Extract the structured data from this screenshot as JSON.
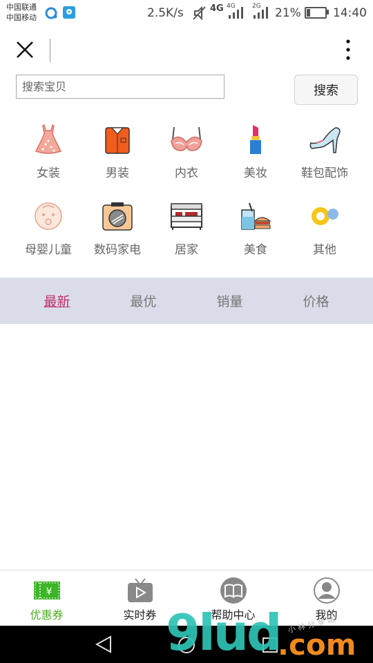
{
  "status_bar": {
    "carrier_line1": "中国联通",
    "carrier_line2": "中国移动",
    "network_speed": "2.5K/s",
    "signal_1_label": "4G",
    "signal_2_label": "2G",
    "battery_percent": "21%",
    "battery_level": 0.21,
    "time": "14:40"
  },
  "header": {
    "close_icon": "close-icon",
    "more_icon": "more-vertical-icon"
  },
  "search": {
    "placeholder": "搜索宝贝",
    "value": "",
    "button_label": "搜索"
  },
  "categories": [
    {
      "label": "女装",
      "icon": "dress-icon"
    },
    {
      "label": "男装",
      "icon": "shirt-icon"
    },
    {
      "label": "内衣",
      "icon": "bra-icon"
    },
    {
      "label": "美妆",
      "icon": "lipstick-icon"
    },
    {
      "label": "鞋包配饰",
      "icon": "high-heel-icon"
    },
    {
      "label": "母婴儿童",
      "icon": "baby-icon"
    },
    {
      "label": "数码家电",
      "icon": "camera-icon"
    },
    {
      "label": "居家",
      "icon": "bed-icon"
    },
    {
      "label": "美食",
      "icon": "food-icon"
    },
    {
      "label": "其他",
      "icon": "other-icon"
    }
  ],
  "sort_tabs": [
    {
      "label": "最新",
      "active": true
    },
    {
      "label": "最优",
      "active": false
    },
    {
      "label": "销量",
      "active": false
    },
    {
      "label": "价格",
      "active": false
    }
  ],
  "bottom_nav": [
    {
      "label": "优惠券",
      "icon": "coupon-icon",
      "active": true
    },
    {
      "label": "实时券",
      "icon": "tv-play-icon",
      "active": false
    },
    {
      "label": "帮助中心",
      "icon": "book-icon",
      "active": false
    },
    {
      "label": "我的",
      "icon": "user-icon",
      "active": false
    }
  ],
  "system_nav": {
    "back_icon": "back-triangle-icon",
    "home_icon": "home-circle-icon",
    "recents_icon": "recents-square-icon"
  },
  "watermark": {
    "text_main": "9lud",
    "text_suffix": ".com",
    "text_small": "小 林 分 享 站"
  },
  "colors": {
    "accent_active_tab": "#c0306a",
    "sortbar_bg": "#dadde9",
    "nav_active": "#4caf1e"
  }
}
